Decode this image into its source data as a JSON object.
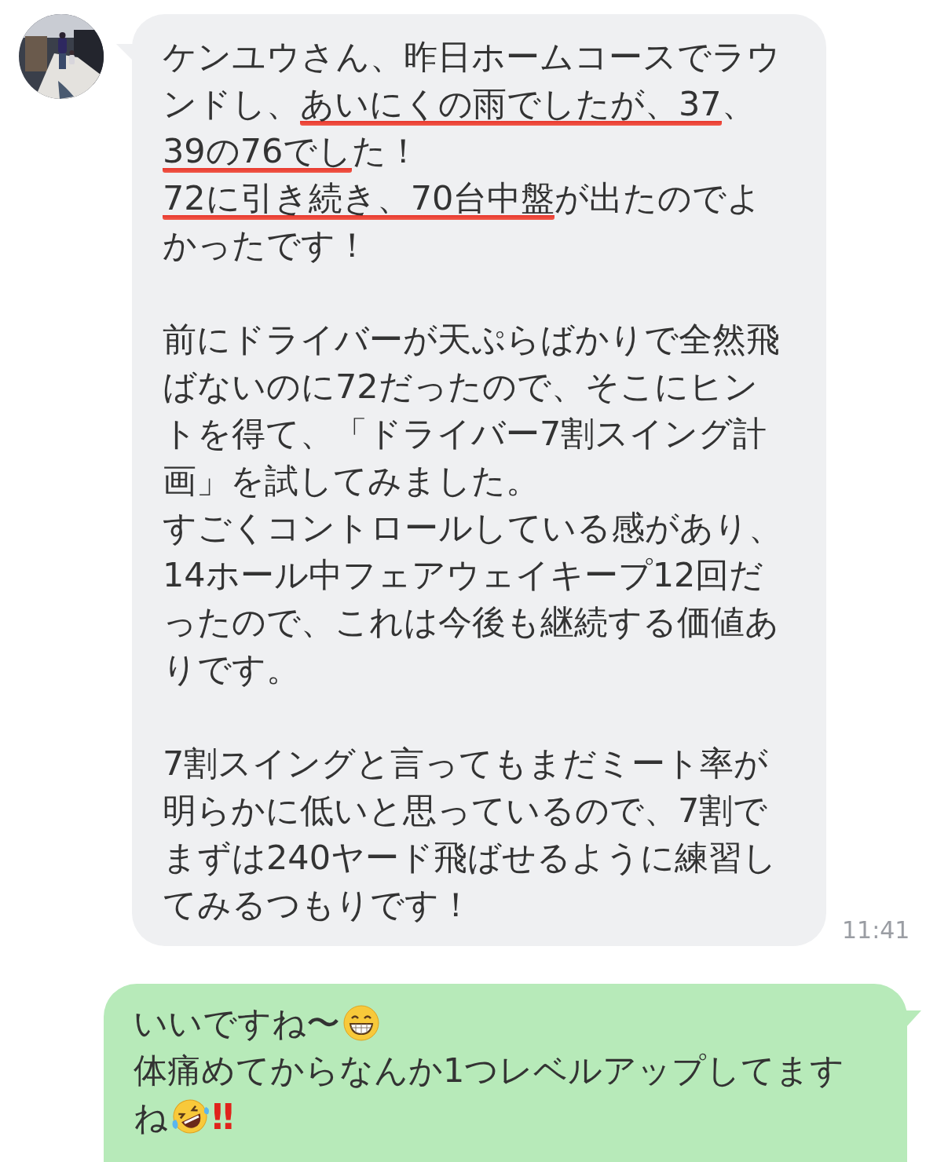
{
  "messages": [
    {
      "kind": "received",
      "avatar": {
        "kind": "picture"
      },
      "time": "11:41",
      "paragraphs": [
        [
          [
            {
              "kind": "text",
              "text": "ケンユウさん、昨日ホームコースでラウ",
              "underlined": false
            }
          ],
          [
            {
              "kind": "text",
              "text": "ンドし、",
              "underlined": false
            },
            {
              "kind": "text",
              "text": "あいにくの雨でしたが、37",
              "underlined": true
            },
            {
              "kind": "text",
              "text": "、",
              "underlined": false
            }
          ],
          [
            {
              "kind": "text",
              "text": "39の76でし",
              "underlined": true
            },
            {
              "kind": "text",
              "text": "た！",
              "underlined": false
            }
          ],
          [
            {
              "kind": "text",
              "text": "72に引き続き、70台中盤",
              "underlined": true
            },
            {
              "kind": "text",
              "text": "が出たのでよ",
              "underlined": false
            }
          ],
          [
            {
              "kind": "text",
              "text": "かったです！",
              "underlined": false
            }
          ]
        ],
        [
          [
            {
              "kind": "text",
              "text": "前にドライバーが天ぷらばかりで全然飛",
              "underlined": false
            }
          ],
          [
            {
              "kind": "text",
              "text": "ばないのに72だったので、そこにヒン",
              "underlined": false
            }
          ],
          [
            {
              "kind": "text",
              "text": "トを得て、「ドライバー7割スイング計",
              "underlined": false
            }
          ],
          [
            {
              "kind": "text",
              "text": "画」を試してみました。",
              "underlined": false
            }
          ],
          [
            {
              "kind": "text",
              "text": "すごくコントロールしている感があり、",
              "underlined": false
            }
          ],
          [
            {
              "kind": "text",
              "text": "14ホール中フェアウェイキープ12回だ",
              "underlined": false
            }
          ],
          [
            {
              "kind": "text",
              "text": "ったので、これは今後も継続する価値あ",
              "underlined": false
            }
          ],
          [
            {
              "kind": "text",
              "text": "りです。",
              "underlined": false
            }
          ]
        ],
        [
          [
            {
              "kind": "text",
              "text": "7割スイングと言ってもまだミート率が",
              "underlined": false
            }
          ],
          [
            {
              "kind": "text",
              "text": "明らかに低いと思っているので、7割で",
              "underlined": false
            }
          ],
          [
            {
              "kind": "text",
              "text": "まずは240ヤード飛ばせるように練習し",
              "underlined": false
            }
          ],
          [
            {
              "kind": "text",
              "text": "てみるつもりです！",
              "underlined": false
            }
          ]
        ]
      ]
    },
    {
      "kind": "sent",
      "paragraphs": [
        [
          [
            {
              "kind": "text",
              "text": "いいですね〜",
              "underlined": false
            },
            {
              "kind": "grin"
            }
          ],
          [
            {
              "kind": "text",
              "text": "体痛めてからなんか1つレベルアップしてます",
              "underlined": false
            }
          ],
          [
            {
              "kind": "text",
              "text": "ね",
              "underlined": false
            },
            {
              "kind": "rofl"
            },
            {
              "kind": "text",
              "text": "‼",
              "color": "#e0231b"
            }
          ]
        ]
      ]
    }
  ]
}
